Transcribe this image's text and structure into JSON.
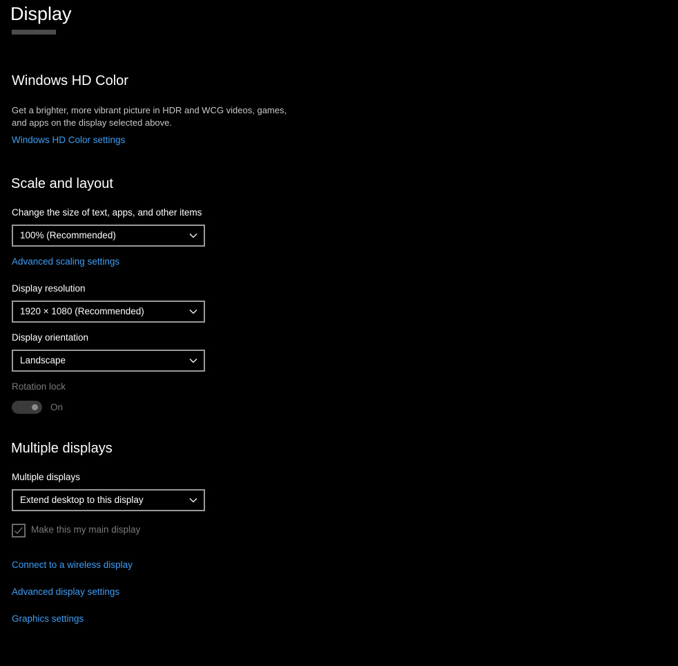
{
  "page": {
    "title": "Display"
  },
  "hd_color": {
    "heading": "Windows HD Color",
    "description_line1": "Get a brighter, more vibrant picture in HDR and WCG videos, games,",
    "description_line2": "and apps on the display selected above.",
    "settings_link": "Windows HD Color settings"
  },
  "scale_layout": {
    "heading": "Scale and layout",
    "scale_label": "Change the size of text, apps, and other items",
    "scale_value": "100% (Recommended)",
    "advanced_scaling_link": "Advanced scaling settings",
    "resolution_label": "Display resolution",
    "resolution_value": "1920 × 1080 (Recommended)",
    "orientation_label": "Display orientation",
    "orientation_value": "Landscape",
    "rotation_lock_label": "Rotation lock",
    "rotation_lock_state": "On"
  },
  "multiple_displays": {
    "heading": "Multiple displays",
    "label": "Multiple displays",
    "value": "Extend desktop to this display",
    "main_display_label": "Make this my main display",
    "wireless_link": "Connect to a wireless display",
    "advanced_display_link": "Advanced display settings",
    "graphics_link": "Graphics settings"
  },
  "colors": {
    "background": "#000000",
    "link": "#3e9ef5",
    "disabled": "#7a7a7a"
  },
  "icons": {
    "dropdown": "chevron-down-icon",
    "checkbox": "checkmark-icon"
  }
}
